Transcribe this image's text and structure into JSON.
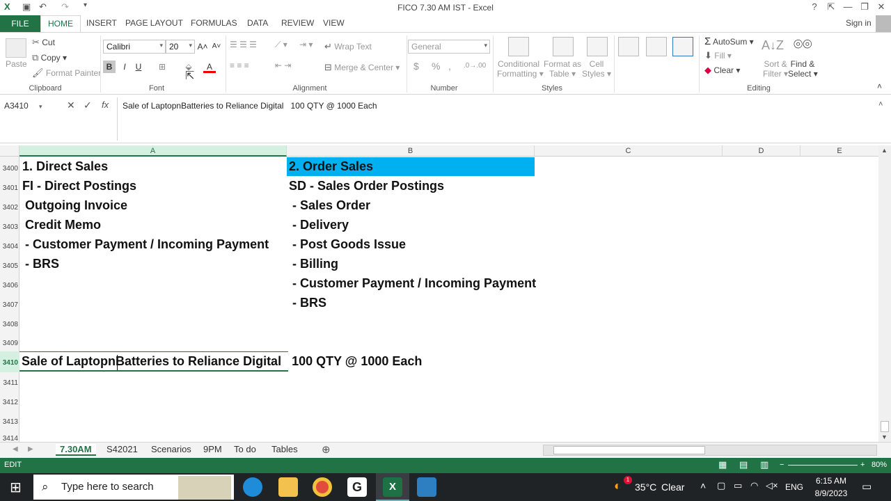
{
  "window": {
    "title": "FICO 7.30 AM IST - Excel",
    "help": "?",
    "minimize": "—",
    "restore": "❐",
    "close": "✕"
  },
  "ribbon_tabs": {
    "file": "FILE",
    "home": "HOME",
    "insert": "INSERT",
    "page_layout": "PAGE LAYOUT",
    "formulas": "FORMULAS",
    "data": "DATA",
    "review": "REVIEW",
    "view": "VIEW",
    "sign_in": "Sign in"
  },
  "clipboard": {
    "paste": "Paste",
    "cut": "Cut",
    "copy": "Copy",
    "format_painter": "Format Painter",
    "label": "Clipboard"
  },
  "font": {
    "name": "Calibri",
    "size": "20",
    "bold": "B",
    "italic": "I",
    "underline": "U",
    "label": "Font"
  },
  "alignment": {
    "wrap_text": "Wrap Text",
    "merge_center": "Merge & Center",
    "label": "Alignment"
  },
  "number": {
    "format": "General",
    "currency": "$",
    "percent": "%",
    "comma": ",",
    "label": "Number"
  },
  "styles": {
    "conditional_1": "Conditional",
    "conditional_2": "Formatting",
    "format_table_1": "Format as",
    "format_table_2": "Table",
    "cell_styles_1": "Cell",
    "cell_styles_2": "Styles",
    "label": "Styles"
  },
  "cells": {
    "a3400": "1. Direct Sales",
    "a3401": "FI - Direct Postings",
    "a3402": " Outgoing Invoice",
    "a3403": " Credit Memo",
    "a3404": " - Customer Payment / Incoming Payment",
    "a3405": " - BRS",
    "b3400": "2. Order Sales",
    "b3401": "SD - Sales Order Postings",
    "b3402": " - Sales Order",
    "b3403": " - Delivery",
    "b3404": " - Post Goods Issue",
    "b3405": " - Billing",
    "b3406": " - Customer Payment / Incoming Payment",
    "b3407": " - BRS",
    "a3410": "Sale of LaptopnBatteries to Reliance Digital   100 QTY @ 1000 Each"
  },
  "editing": {
    "autosum": "AutoSum",
    "fill": "Fill",
    "clear": "Clear",
    "sort_1": "Sort &",
    "sort_2": "Filter",
    "find_1": "Find &",
    "find_2": "Select",
    "label": "Editing"
  },
  "formula_bar": {
    "name_box": "A3410",
    "cancel": "✕",
    "enter": "✓",
    "fx": "fx",
    "content": "Sale of LaptopnBatteries to Reliance Digital   100 QTY @ 1000 Each"
  },
  "columns": [
    "A",
    "B",
    "C",
    "D",
    "E"
  ],
  "rows": [
    "3400",
    "3401",
    "3402",
    "3403",
    "3404",
    "3405",
    "3406",
    "3407",
    "3408",
    "3409",
    "3410",
    "3411",
    "3412",
    "3413",
    "3414"
  ],
  "colors": {
    "excel_green": "#217346",
    "highlight_b3400": "#00b0f0"
  },
  "sheets": [
    "7.30AM",
    "S42021",
    "Scenarios",
    "9PM",
    "To do",
    "Tables"
  ],
  "active_sheet": "7.30AM",
  "status": {
    "mode": "EDIT",
    "zoom": "80%"
  },
  "taskbar": {
    "search_placeholder": "Type here to search",
    "temp": "35°C",
    "weather": "Clear",
    "lang": "ENG",
    "time": "6:15 AM",
    "date": "8/9/2023",
    "weather_badge": "1"
  }
}
